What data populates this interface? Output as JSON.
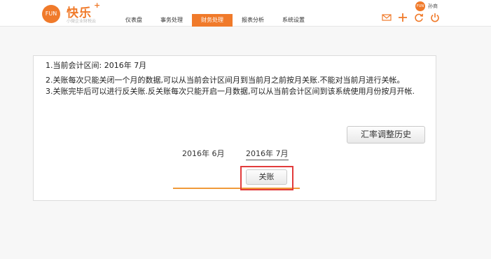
{
  "brand": {
    "logo_mark": "FUN",
    "name": "快乐",
    "plus": "+",
    "tagline": "小微企业财税云"
  },
  "nav": {
    "items": [
      {
        "label": "仪表盘",
        "active": false
      },
      {
        "label": "事务处理",
        "active": false
      },
      {
        "label": "财务处理",
        "active": true
      },
      {
        "label": "报表分析",
        "active": false
      },
      {
        "label": "系统设置",
        "active": false
      }
    ]
  },
  "user": {
    "avatar_text": "FUN",
    "name": "孙商"
  },
  "header_icons": [
    "mail-icon",
    "plus-icon",
    "refresh-icon",
    "power-icon"
  ],
  "notes": [
    "1.当前会计区间: 2016年 7月",
    "2.关账每次只能关闭一个月的数据,可以从当前会计区间月到当前月之前按月关账.不能对当前月进行关帐。",
    "3.关账完毕后可以进行反关账.反关账每次只能开启一月数据,可以从当前会计区间到该系统使用月份按月开帐."
  ],
  "buttons": {
    "history": "汇率调整历史",
    "close_period": "关账"
  },
  "months": {
    "previous": "2016年 6月",
    "current": "2016年 7月"
  },
  "colors": {
    "accent": "#f07a2a",
    "highlight": "#e23b3b"
  }
}
